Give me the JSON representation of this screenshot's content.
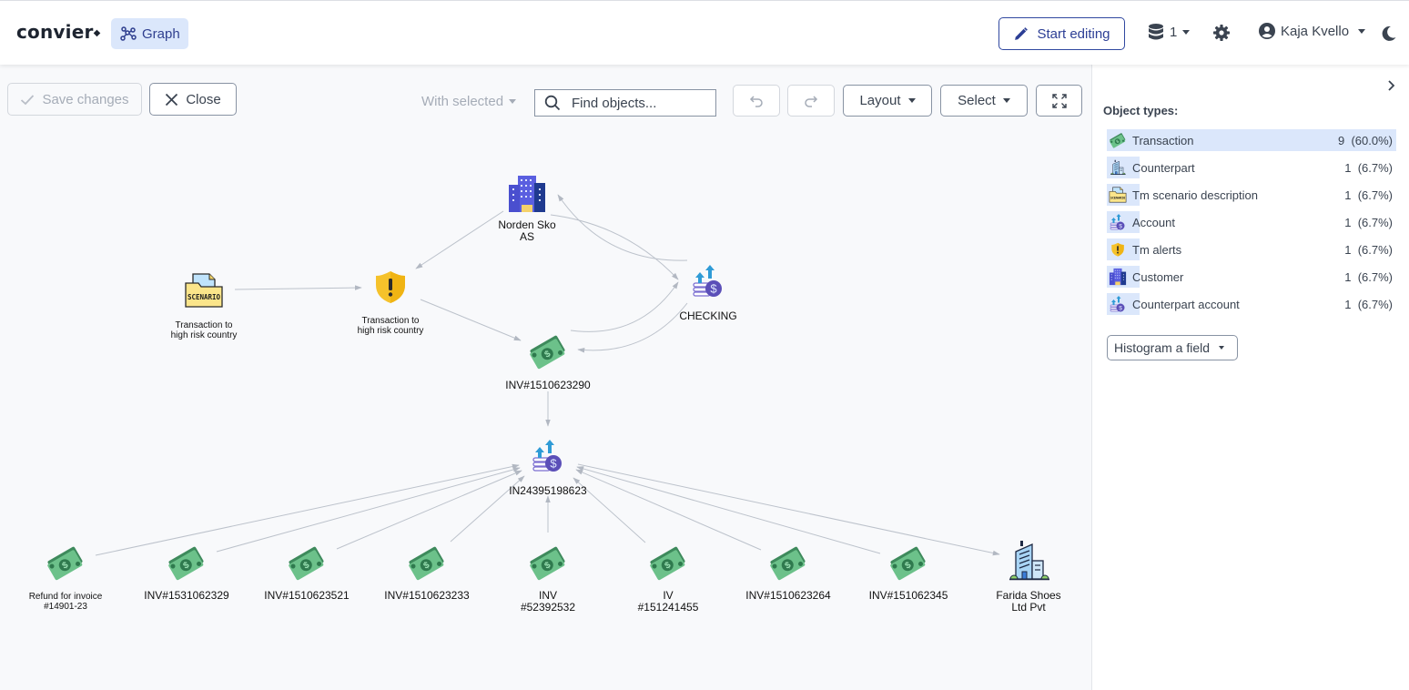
{
  "app": {
    "logo": "convier",
    "active_tab": "Graph"
  },
  "header": {
    "start_editing_label": "Start editing",
    "db_count": "1",
    "user_name": "Kaja Kvello"
  },
  "toolbar": {
    "save_label": "Save changes",
    "close_label": "Close",
    "with_selected_label": "With selected",
    "search_placeholder": "Find objects...",
    "layout_label": "Layout",
    "select_label": "Select"
  },
  "sidebar": {
    "title": "Object types:",
    "histogram_label": "Histogram a field",
    "object_types": [
      {
        "label": "Transaction",
        "count": "9",
        "percent": "(60.0%)",
        "fraction": 0.6,
        "icon": "money-icon"
      },
      {
        "label": "Counterpart",
        "count": "1",
        "percent": "(6.7%)",
        "fraction": 0.067,
        "icon": "office-building-icon"
      },
      {
        "label": "Tm scenario description",
        "count": "1",
        "percent": "(6.7%)",
        "fraction": 0.067,
        "icon": "scenario-folder-icon"
      },
      {
        "label": "Account",
        "count": "1",
        "percent": "(6.7%)",
        "fraction": 0.067,
        "icon": "account-coins-icon"
      },
      {
        "label": "Tm alerts",
        "count": "1",
        "percent": "(6.7%)",
        "fraction": 0.067,
        "icon": "alert-shield-icon"
      },
      {
        "label": "Customer",
        "count": "1",
        "percent": "(6.7%)",
        "fraction": 0.067,
        "icon": "company-building-icon"
      },
      {
        "label": "Counterpart account",
        "count": "1",
        "percent": "(6.7%)",
        "fraction": 0.067,
        "icon": "account-coins-icon"
      }
    ]
  },
  "graph": {
    "nodes": [
      {
        "id": "norden",
        "type": "Customer",
        "icon": "company-building-icon",
        "label": [
          "Norden Sko",
          "AS"
        ]
      },
      {
        "id": "scenario",
        "type": "Tm scenario description",
        "icon": "scenario-folder-icon",
        "label": [
          "Transaction to",
          "high risk country"
        ]
      },
      {
        "id": "alert",
        "type": "Tm alerts",
        "icon": "alert-shield-icon",
        "label": [
          "Transaction to",
          "high risk country"
        ]
      },
      {
        "id": "checking",
        "type": "Account",
        "icon": "account-coins-icon",
        "label": [
          "CHECKING"
        ]
      },
      {
        "id": "inv290",
        "type": "Transaction",
        "icon": "money-icon",
        "label": [
          "INV#1510623290"
        ]
      },
      {
        "id": "acct623",
        "type": "Counterpart account",
        "icon": "account-coins-icon",
        "label": [
          "IN24395198623"
        ]
      },
      {
        "id": "refund",
        "type": "Transaction",
        "icon": "money-icon",
        "label": [
          "Refund for invoice",
          "#14901-23"
        ]
      },
      {
        "id": "inv329",
        "type": "Transaction",
        "icon": "money-icon",
        "label": [
          "INV#1531062329"
        ]
      },
      {
        "id": "inv521",
        "type": "Transaction",
        "icon": "money-icon",
        "label": [
          "INV#1510623521"
        ]
      },
      {
        "id": "inv233",
        "type": "Transaction",
        "icon": "money-icon",
        "label": [
          "INV#1510623233"
        ]
      },
      {
        "id": "inv532",
        "type": "Transaction",
        "icon": "money-icon",
        "label": [
          "INV",
          "#52392532"
        ]
      },
      {
        "id": "iv455",
        "type": "Transaction",
        "icon": "money-icon",
        "label": [
          "IV",
          "#151241455"
        ]
      },
      {
        "id": "inv264",
        "type": "Transaction",
        "icon": "money-icon",
        "label": [
          "INV#1510623264"
        ]
      },
      {
        "id": "inv345",
        "type": "Transaction",
        "icon": "money-icon",
        "label": [
          "INV#151062345"
        ]
      },
      {
        "id": "farida",
        "type": "Counterpart",
        "icon": "office-building-icon",
        "label": [
          "Farida Shoes",
          "Ltd Pvt"
        ]
      }
    ],
    "edges": [
      {
        "from": "norden",
        "to": "alert"
      },
      {
        "from": "scenario",
        "to": "alert"
      },
      {
        "from": "alert",
        "to": "inv290"
      },
      {
        "from": "norden",
        "to": "checking"
      },
      {
        "from": "checking",
        "to": "norden"
      },
      {
        "from": "inv290",
        "to": "checking"
      },
      {
        "from": "checking",
        "to": "inv290"
      },
      {
        "from": "inv290",
        "to": "acct623"
      },
      {
        "from": "refund",
        "to": "acct623"
      },
      {
        "from": "inv329",
        "to": "acct623"
      },
      {
        "from": "inv521",
        "to": "acct623"
      },
      {
        "from": "inv233",
        "to": "acct623"
      },
      {
        "from": "inv532",
        "to": "acct623"
      },
      {
        "from": "iv455",
        "to": "acct623"
      },
      {
        "from": "inv264",
        "to": "acct623"
      },
      {
        "from": "inv345",
        "to": "acct623"
      },
      {
        "from": "acct623",
        "to": "farida"
      }
    ]
  },
  "colors": {
    "accent": "#2c3e95",
    "tab_bg": "#dbe7fb",
    "edge": "#b8bec8",
    "money_green": "#6cc18a"
  }
}
